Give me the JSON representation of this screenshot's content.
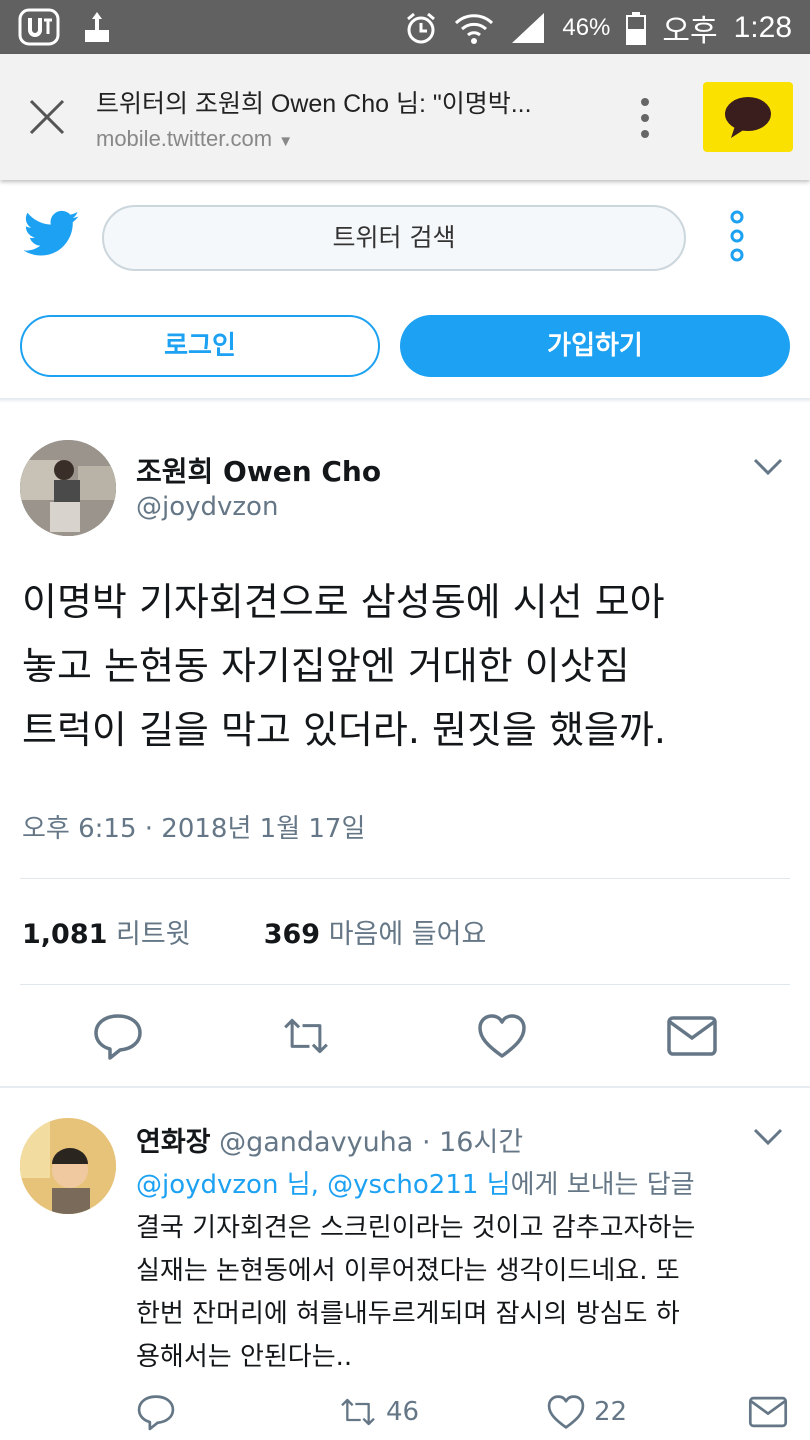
{
  "status_bar": {
    "battery": "46%",
    "ampm": "오후",
    "time": "1:28"
  },
  "browser": {
    "title": "트위터의 조원희 Owen Cho 님: \"이명박...",
    "url": "mobile.twitter.com"
  },
  "twitter_nav": {
    "search_label": "트위터 검색",
    "login": "로그인",
    "signup": "가입하기"
  },
  "tweet": {
    "author_name": "조원희 Owen Cho",
    "author_handle": "@joydvzon",
    "text_line1": "이명박 기자회견으로 삼성동에 시선 모아",
    "text_line2": "놓고 논현동 자기집앞엔 거대한 이삿짐",
    "text_line3": "트럭이 길을 막고 있더라. 뭔짓을 했을까.",
    "time": "오후 6:15",
    "date": "2018년 1월 17일",
    "retweet_count": "1,081",
    "retweet_label": "리트윗",
    "like_count": "369",
    "like_label": "마음에 들어요"
  },
  "reply": {
    "author_name": "연화장",
    "author_handle": "@gandavyuha",
    "age": "16시간",
    "mention1": "@joydvzon 님,",
    "mention2": "@yscho211 님",
    "to_suffix": "에게 보내는 답글",
    "line1": "결국 기자회견은 스크린이라는 것이고 감추고자하는",
    "line2": "실재는 논현동에서 이루어졌다는 생각이드네요. 또",
    "line3": "한번 잔머리에 혀를내두르게되며 잠시의 방심도 하",
    "line4": "용해서는 안된다는..",
    "retweets": "46",
    "likes": "22"
  },
  "colors": {
    "twitter_blue": "#1da1f2",
    "kakao_yellow": "#fae100",
    "status_bar": "#616161",
    "secondary_text": "#657786"
  }
}
